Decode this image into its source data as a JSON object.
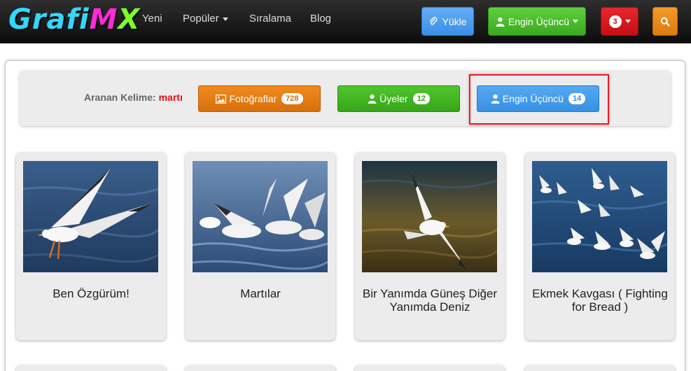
{
  "app": {
    "logo_parts": [
      "Grafi",
      "M",
      "X"
    ]
  },
  "nav": {
    "links": [
      {
        "label": "Yeni"
      },
      {
        "label": "Popüler"
      },
      {
        "label": "Sıralama"
      },
      {
        "label": "Blog"
      }
    ],
    "upload_label": "Yükle",
    "user_label": "Engin Üçüncü",
    "notification_count": "3",
    "search_icon": "search-icon"
  },
  "search": {
    "label": "Aranan Kelime:",
    "keyword": "martı",
    "buttons": [
      {
        "label": "Fotoğraflar",
        "count": "728",
        "icon": "image-icon",
        "color": "#e07a11"
      },
      {
        "label": "Üyeler",
        "count": "12",
        "icon": "user-icon",
        "color": "#3fae22"
      },
      {
        "label": "Engin Üçüncü",
        "count": "14",
        "icon": "user-icon",
        "color": "#3f95e6"
      }
    ]
  },
  "photos": [
    {
      "title": "Ben Özgürüm!"
    },
    {
      "title": "Martılar"
    },
    {
      "title": "Bir Yanımda Güneş Diğer Yanımda Deniz"
    },
    {
      "title": "Ekmek Kavgası ( Fighting for Bread )"
    }
  ],
  "colors": {
    "navbar": "#1a1a1a",
    "highlight": "#e21e26",
    "keyword": "#e81010"
  }
}
